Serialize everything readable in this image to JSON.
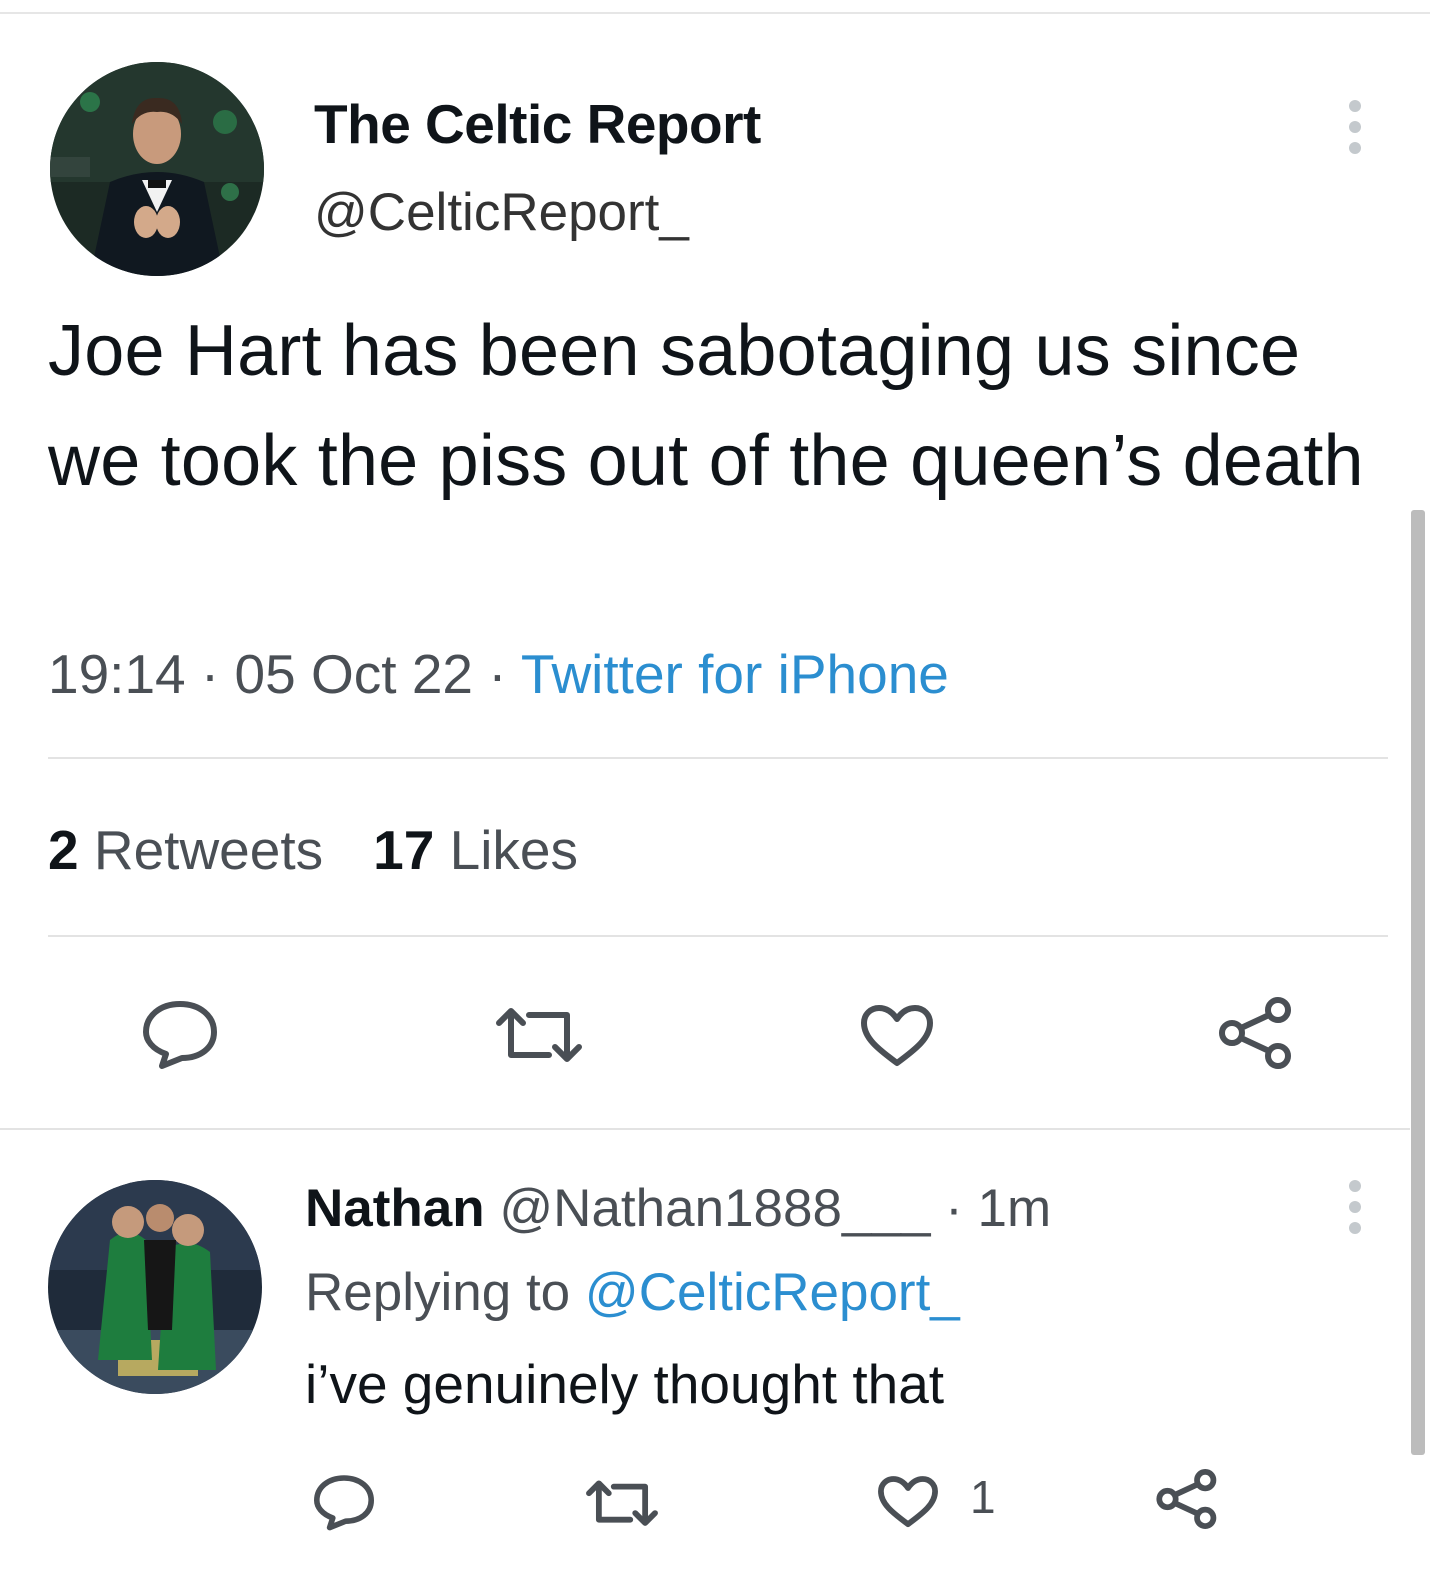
{
  "tweet": {
    "author": {
      "display_name": "The Celtic Report",
      "handle": "@CelticReport_"
    },
    "text": "Joe Hart has been sabotaging us since we took the piss out of the queen’s death",
    "time": "19:14",
    "date": "05 Oct 22",
    "source": "Twitter for iPhone",
    "separator": " · ",
    "retweets_count": "2",
    "retweets_label": "Retweets",
    "likes_count": "17",
    "likes_label": "Likes"
  },
  "reply": {
    "author": {
      "display_name": "Nathan",
      "handle": "@Nathan1888___"
    },
    "time_ago": "· 1m",
    "replying_prefix": "Replying to ",
    "replying_to": "@CelticReport_",
    "text": "i’ve genuinely thought that",
    "like_count": "1"
  },
  "icons": {
    "reply": "reply-icon",
    "retweet": "retweet-icon",
    "like": "heart-icon",
    "share": "share-icon",
    "more": "more-icon"
  },
  "colors": {
    "link": "#2b8ed0",
    "text": "#0f1419",
    "secondary": "#4a4f55",
    "divider": "#e3e3e3"
  }
}
